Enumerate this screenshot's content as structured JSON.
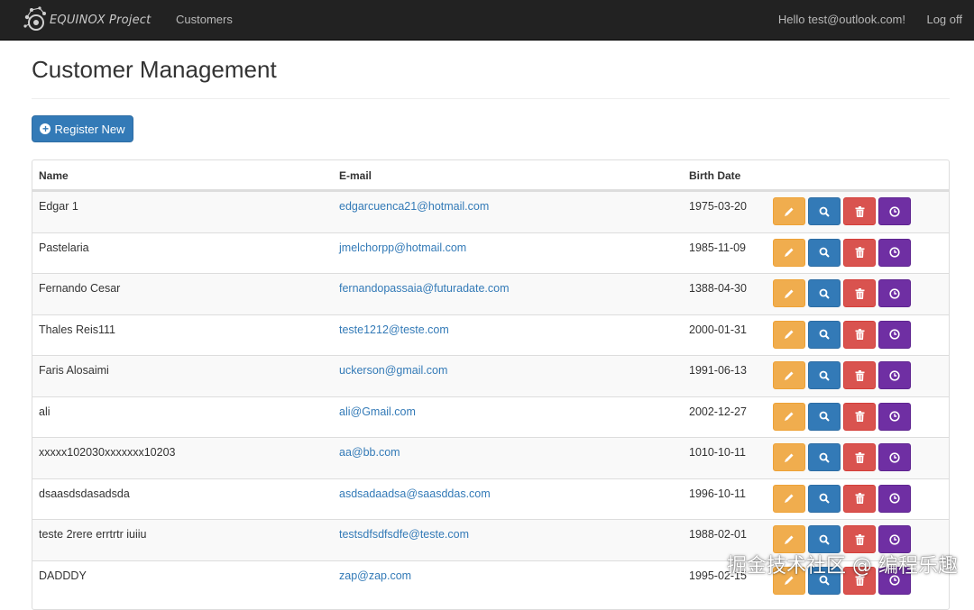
{
  "navbar": {
    "brand_text": "EQUINOX Project",
    "customers_link": "Customers",
    "hello_text": "Hello test@outlook.com!",
    "logoff_text": "Log off"
  },
  "page": {
    "title": "Customer Management",
    "register_label": "Register New"
  },
  "table": {
    "headers": {
      "name": "Name",
      "email": "E-mail",
      "birth": "Birth Date"
    },
    "rows": [
      {
        "name": "Edgar 1",
        "email": "edgarcuenca21@hotmail.com",
        "birth": "1975-03-20"
      },
      {
        "name": " Pastelaria",
        "email": "jmelchorpp@hotmail.com",
        "birth": "1985-11-09"
      },
      {
        "name": "Fernando Cesar",
        "email": "fernandopassaia@futuradate.com",
        "birth": "1388-04-30"
      },
      {
        "name": "Thales Reis111",
        "email": "teste1212@teste.com",
        "birth": "2000-01-31"
      },
      {
        "name": "Faris Alosaimi",
        "email": "uckerson@gmail.com",
        "birth": "1991-06-13"
      },
      {
        "name": "ali",
        "email": "ali@Gmail.com",
        "birth": "2002-12-27"
      },
      {
        "name": "xxxxx102030xxxxxxx10203",
        "email": "aa@bb.com",
        "birth": "1010-10-11"
      },
      {
        "name": "dsaasdsdasadsda",
        "email": "asdsadaadsa@saasddas.com",
        "birth": "1996-10-11"
      },
      {
        "name": "teste 2rere errtrtr iuiiu",
        "email": "testsdfsdfsdfe@teste.com",
        "birth": "1988-02-01"
      },
      {
        "name": "DADDDY",
        "email": "zap@zap.com",
        "birth": "1995-02-15"
      }
    ]
  },
  "watermark": "掘金技术社区 @ 编程乐趣",
  "colors": {
    "navbar_bg": "#222222",
    "primary": "#337ab7",
    "warning": "#f0ad4e",
    "danger": "#d9534f",
    "purple": "#6f2fa3"
  },
  "icons": {
    "register": "plus-circle-icon",
    "edit": "pencil-icon",
    "view": "search-icon",
    "delete": "trash-icon",
    "history": "clock-icon"
  }
}
